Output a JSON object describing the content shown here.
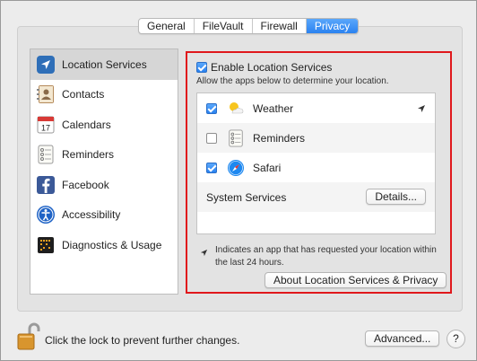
{
  "tabs": [
    "General",
    "FileVault",
    "Firewall",
    "Privacy"
  ],
  "active_tab": "Privacy",
  "sidebar": {
    "items": [
      {
        "label": "Location Services",
        "icon": "location-arrow-icon"
      },
      {
        "label": "Contacts",
        "icon": "contacts-icon"
      },
      {
        "label": "Calendars",
        "icon": "calendar-icon"
      },
      {
        "label": "Reminders",
        "icon": "reminders-icon"
      },
      {
        "label": "Facebook",
        "icon": "facebook-icon"
      },
      {
        "label": "Accessibility",
        "icon": "accessibility-icon"
      },
      {
        "label": "Diagnostics & Usage",
        "icon": "diagnostics-icon"
      }
    ],
    "selected": "Location Services",
    "calendar_day": "17"
  },
  "main": {
    "enable_label": "Enable Location Services",
    "enable_checked": true,
    "allow_text": "Allow the apps below to determine your location.",
    "apps": [
      {
        "name": "Weather",
        "checked": true,
        "recent": true,
        "icon": "weather-icon"
      },
      {
        "name": "Reminders",
        "checked": false,
        "recent": false,
        "icon": "reminders-icon"
      },
      {
        "name": "Safari",
        "checked": true,
        "recent": false,
        "icon": "safari-icon"
      }
    ],
    "system_services_label": "System Services",
    "details_button": "Details...",
    "note": "Indicates an app that has requested your location within the last 24 hours.",
    "about_button": "About Location Services & Privacy"
  },
  "footer": {
    "lock_text": "Click the lock to prevent further changes.",
    "advanced_button": "Advanced...",
    "help_button": "?"
  },
  "colors": {
    "accent": "#2a82f0",
    "highlight_border": "#e0181c",
    "facebook": "#3b5998"
  }
}
